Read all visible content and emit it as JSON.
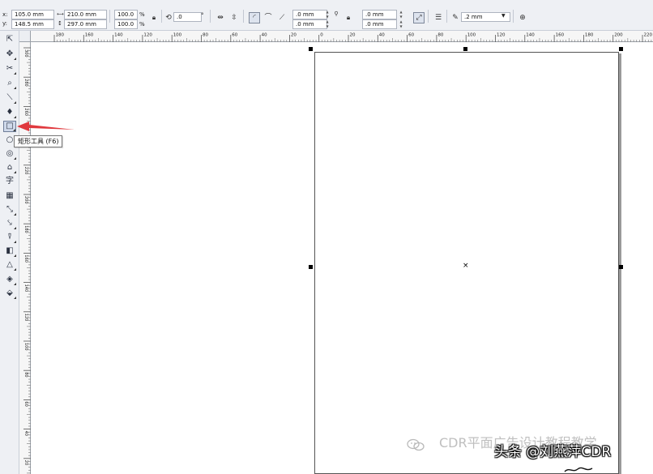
{
  "propbar": {
    "x_label": "x:",
    "x_value": "105.0 mm",
    "y_label": "y:",
    "y_value": "148.5 mm",
    "width_value": "210.0 mm",
    "height_value": "297.0 mm",
    "scale_x": "100.0",
    "scale_y": "100.0",
    "percent": "%",
    "rotation": ".0",
    "degree": "°",
    "corner_top": ".0 mm",
    "corner_bottom": ".0 mm",
    "corner_top_right": ".0 mm",
    "corner_bottom_right": ".0 mm",
    "outline_width": ".2 mm"
  },
  "hruler": {
    "labels": [
      "180",
      "160",
      "140",
      "120",
      "100",
      "80",
      "60",
      "40",
      "20",
      "0",
      "20",
      "40",
      "60",
      "80",
      "100",
      "120",
      "140",
      "160",
      "180",
      "200",
      "220"
    ]
  },
  "vruler": {
    "labels": [
      "300",
      "280",
      "260",
      "240",
      "220",
      "200",
      "180",
      "160",
      "140",
      "120",
      "100",
      "80",
      "60",
      "40",
      "20"
    ]
  },
  "tooltip": {
    "text": "矩形工具 (F6)"
  },
  "watermarks": {
    "line1": "CDR平面广告设计教程教学",
    "line2": "头条 @刘燕萍CDR"
  },
  "colors": {
    "arrow": "#e0393e",
    "selection_handle": "#000000"
  }
}
